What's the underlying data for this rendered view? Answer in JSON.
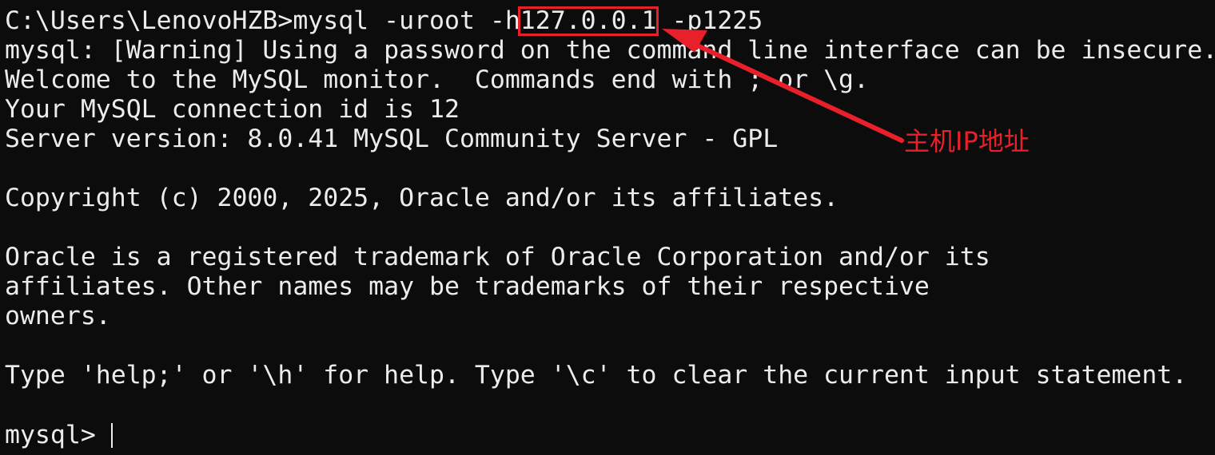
{
  "terminal": {
    "lines": [
      "C:\\Users\\LenovoHZB>mysql -uroot -h127.0.0.1 -p1225",
      "mysql: [Warning] Using a password on the command line interface can be insecure.",
      "Welcome to the MySQL monitor.  Commands end with ; or \\g.",
      "Your MySQL connection id is 12",
      "Server version: 8.0.41 MySQL Community Server - GPL",
      "",
      "Copyright (c) 2000, 2025, Oracle and/or its affiliates.",
      "",
      "Oracle is a registered trademark of Oracle Corporation and/or its",
      "affiliates. Other names may be trademarks of their respective",
      "owners.",
      "",
      "Type 'help;' or '\\h' for help. Type '\\c' to clear the current input statement."
    ],
    "prompt": "mysql> "
  },
  "annotation": {
    "label": "主机IP地址",
    "highlight_color": "#e8202a"
  },
  "colors": {
    "background": "#0c0c0c",
    "text": "#ececec",
    "accent": "#e8202a"
  }
}
